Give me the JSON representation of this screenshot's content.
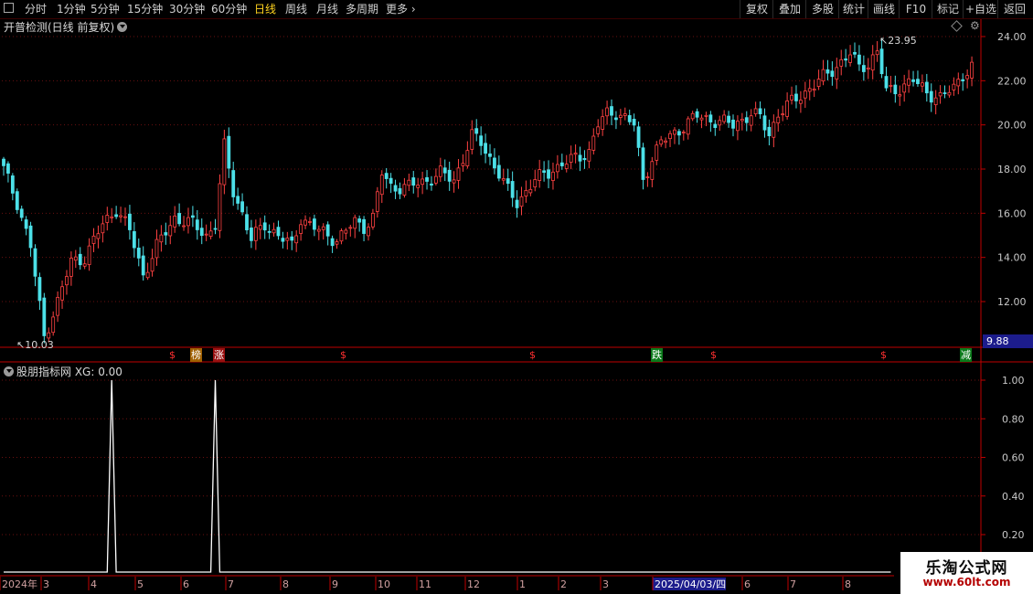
{
  "toolbar": {
    "periods": [
      "分时",
      "1分钟",
      "5分钟",
      "15分钟",
      "30分钟",
      "60分钟",
      "日线",
      "周线",
      "月线",
      "多周期",
      "更多"
    ],
    "active_period": "日线",
    "right_buttons": [
      "复权",
      "叠加",
      "多股",
      "统计",
      "画线",
      "F10",
      "标记",
      "+自选",
      "返回"
    ]
  },
  "main_panel": {
    "title": "开普检测(日线 前复权)",
    "high_label": "23.95",
    "low_label": "10.03",
    "current_price_box": "9.88",
    "y_ticks": [
      "24.00",
      "22.00",
      "20.00",
      "18.00",
      "16.00",
      "14.00",
      "12.00"
    ]
  },
  "markers": [
    {
      "text": "$",
      "color": "#ff3030",
      "bg": "none"
    },
    {
      "text": "榜",
      "color": "#ffffff",
      "bg": "#a06000"
    },
    {
      "text": "涨",
      "color": "#ffffff",
      "bg": "#9a1010"
    },
    {
      "text": "$",
      "color": "#ff3030",
      "bg": "none"
    },
    {
      "text": "$",
      "color": "#ff3030",
      "bg": "none"
    },
    {
      "text": "跌",
      "color": "#ffffff",
      "bg": "#0a7a1a"
    },
    {
      "text": "$",
      "color": "#ff3030",
      "bg": "none"
    },
    {
      "text": "$",
      "color": "#ff3030",
      "bg": "none"
    },
    {
      "text": "减",
      "color": "#ffffff",
      "bg": "#0a7a1a"
    }
  ],
  "indicator_panel": {
    "title": "股朋指标网 XG: 0.00",
    "y_ticks": [
      "1.00",
      "0.80",
      "0.60",
      "0.40",
      "0.20"
    ]
  },
  "time_axis": {
    "labels": [
      "2024年",
      "3",
      "4",
      "5",
      "6",
      "7",
      "8",
      "9",
      "10",
      "11",
      "12",
      "1",
      "2",
      "3",
      "2025/04/03/四",
      "6",
      "7",
      "8"
    ],
    "highlighted": "2025/04/03/四"
  },
  "watermark": {
    "title": "乐淘公式网",
    "url": "www.60lt.com"
  },
  "colors": {
    "up": "#ff4242",
    "down": "#4ce0e8",
    "grid": "#6a1010",
    "axis": "#c00000",
    "price_box": "#1c1c8c",
    "active": "#ffd21e"
  },
  "chart_data": [
    {
      "type": "candlestick",
      "y_range": [
        10,
        24.5
      ],
      "y_ticks": [
        24,
        22,
        20,
        18,
        16,
        14,
        12
      ],
      "close_path": [
        [
          0,
          18.0
        ],
        [
          3,
          16.5
        ],
        [
          6,
          14.5
        ],
        [
          9,
          10.4
        ],
        [
          12,
          12.0
        ],
        [
          15,
          13.8
        ],
        [
          18,
          14.0
        ],
        [
          22,
          15.5
        ],
        [
          25,
          16.2
        ],
        [
          28,
          15.2
        ],
        [
          31,
          13.2
        ],
        [
          34,
          14.5
        ],
        [
          38,
          15.8
        ],
        [
          42,
          15.5
        ],
        [
          45,
          15.0
        ],
        [
          47,
          15.5
        ],
        [
          49,
          19.0
        ],
        [
          51,
          17.0
        ],
        [
          53,
          16.0
        ],
        [
          55,
          14.8
        ],
        [
          58,
          15.5
        ],
        [
          61,
          15.0
        ],
        [
          64,
          14.5
        ],
        [
          66,
          15.8
        ],
        [
          70,
          15.2
        ],
        [
          74,
          14.8
        ],
        [
          78,
          15.6
        ],
        [
          80,
          15.4
        ],
        [
          82,
          15.8
        ],
        [
          84,
          17.8
        ],
        [
          86,
          17.2
        ],
        [
          90,
          17.2
        ],
        [
          94,
          17.5
        ],
        [
          97,
          17.8
        ],
        [
          100,
          17.5
        ],
        [
          102,
          18.5
        ],
        [
          104,
          19.5
        ],
        [
          106,
          19.2
        ],
        [
          108,
          18.5
        ],
        [
          110,
          17.8
        ],
        [
          112,
          17.0
        ],
        [
          114,
          16.5
        ],
        [
          116,
          17.0
        ],
        [
          118,
          17.5
        ],
        [
          122,
          18.0
        ],
        [
          126,
          18.4
        ],
        [
          130,
          18.8
        ],
        [
          132,
          20.0
        ],
        [
          134,
          20.5
        ],
        [
          136,
          20.6
        ],
        [
          138,
          20.3
        ],
        [
          140,
          20.0
        ],
        [
          142,
          17.5
        ],
        [
          144,
          18.5
        ],
        [
          146,
          19.2
        ],
        [
          150,
          19.8
        ],
        [
          154,
          20.4
        ],
        [
          158,
          20.2
        ],
        [
          162,
          20.0
        ],
        [
          166,
          20.5
        ],
        [
          168,
          20.3
        ],
        [
          170,
          19.6
        ],
        [
          172,
          20.5
        ],
        [
          176,
          21.2
        ],
        [
          180,
          21.8
        ],
        [
          184,
          22.5
        ],
        [
          188,
          23.2
        ],
        [
          190,
          22.6
        ],
        [
          192,
          22.8
        ],
        [
          194,
          23.3
        ],
        [
          196,
          21.5
        ],
        [
          198,
          21.6
        ],
        [
          202,
          22.0
        ],
        [
          205,
          21.5
        ],
        [
          208,
          21.2
        ],
        [
          211,
          21.7
        ],
        [
          213,
          22.3
        ],
        [
          215,
          22.6
        ]
      ],
      "num_days": 216
    },
    {
      "type": "line",
      "series_name": "XG",
      "y_range": [
        0,
        1.05
      ],
      "y_ticks": [
        1.0,
        0.8,
        0.6,
        0.4,
        0.2
      ],
      "values": [
        0,
        0,
        0,
        0,
        0,
        0,
        0,
        0,
        0,
        0,
        0,
        0,
        0,
        0,
        0,
        0,
        0,
        0,
        0,
        0,
        0,
        0,
        0,
        0,
        1,
        0,
        0,
        0,
        0,
        0,
        0,
        0,
        0,
        0,
        0,
        0,
        0,
        0,
        0,
        0,
        0,
        0,
        0,
        0,
        0,
        0,
        0,
        1,
        0,
        0,
        0,
        0,
        0,
        0,
        0,
        0,
        0,
        0,
        0,
        0,
        0,
        0,
        0,
        0,
        0,
        0,
        0,
        0,
        0,
        0,
        0,
        0,
        0,
        0,
        0,
        0,
        0,
        0,
        0,
        0,
        0,
        0,
        0,
        0,
        0,
        0,
        0,
        0,
        0,
        0,
        0,
        0,
        0,
        0,
        0,
        0,
        0,
        0,
        0,
        0,
        0,
        0,
        0,
        0,
        0,
        0,
        0,
        0,
        0,
        0,
        0,
        0,
        0,
        0,
        0,
        0,
        0,
        0,
        0,
        0,
        0,
        0,
        0,
        0,
        0,
        0,
        0,
        0,
        0,
        0,
        0,
        0,
        0,
        0,
        0,
        0,
        0,
        0,
        0,
        0,
        0,
        0,
        0,
        0,
        0,
        0,
        0,
        0,
        0,
        0,
        0,
        0,
        0,
        0,
        0,
        0,
        0,
        0,
        0,
        0,
        0,
        0,
        0,
        0,
        0,
        0,
        0,
        0,
        0,
        0,
        0,
        0,
        0,
        0,
        0,
        0,
        0,
        0,
        0,
        0,
        0,
        0,
        0,
        0,
        0,
        0,
        0,
        0,
        0,
        0,
        0,
        0,
        0,
        0,
        0,
        0,
        0,
        0
      ]
    }
  ]
}
